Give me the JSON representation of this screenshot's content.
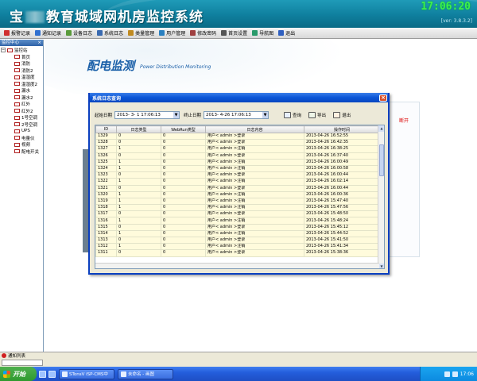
{
  "banner": {
    "title_prefix": "宝",
    "title_suffix": "教育城域网机房监控系统",
    "clock": "17:06:20",
    "version": "[ver: 3.8.3.2]"
  },
  "menu": [
    {
      "label": "报警记录",
      "icon": "alarm-log-icon",
      "color": "#d03030"
    },
    {
      "label": "通知记录",
      "icon": "notice-log-icon",
      "color": "#3070d0"
    },
    {
      "label": "设备日志",
      "icon": "device-log-icon",
      "color": "#5a9a3a"
    },
    {
      "label": "系统日志",
      "icon": "system-log-icon",
      "color": "#3a6ab0"
    },
    {
      "label": "类量管理",
      "icon": "type-manage-icon",
      "color": "#c08a20"
    },
    {
      "label": "用户管理",
      "icon": "user-manage-icon",
      "color": "#2a80c0"
    },
    {
      "label": "修改密码",
      "icon": "password-icon",
      "color": "#a04040"
    },
    {
      "label": "首页设置",
      "icon": "home-settings-icon",
      "color": "#555555"
    },
    {
      "label": "导航图",
      "icon": "nav-map-icon",
      "color": "#2a9a6a"
    },
    {
      "label": "退出",
      "icon": "exit-icon",
      "color": "#3060c0"
    }
  ],
  "left_panel": {
    "header": "监控中心",
    "root": "监控站",
    "items": [
      "首页",
      "消防",
      "消防2",
      "温湿度",
      "温湿度2",
      "漏水",
      "漏水2",
      "红外",
      "红外2",
      "1号空调",
      "2号空调",
      "UPS",
      "电量仪",
      "视频",
      "配电开关"
    ]
  },
  "page": {
    "title": "配电监测",
    "subtitle": "Power Distribution Monitoring",
    "status_text": "断开"
  },
  "dialog": {
    "title": "系统日志查询",
    "start_label": "起始日期",
    "start_value": "2013- 3- 1  17:06:13",
    "end_label": "终止日期",
    "end_value": "2013- 4-26  17:06:13",
    "buttons": [
      "查询",
      "导出",
      "退出"
    ],
    "columns": [
      "ID",
      "日志类型",
      "WebRun类型",
      "日志内容",
      "操作时间"
    ],
    "rows": [
      [
        "1329",
        "0",
        "0",
        "用户< admin >登录",
        "2013-04-26 16:52:55"
      ],
      [
        "1328",
        "0",
        "0",
        "用户< admin >登录",
        "2013-04-26 16:42:35"
      ],
      [
        "1327",
        "1",
        "0",
        "用户< admin >注销",
        "2013-04-26 16:38:25"
      ],
      [
        "1326",
        "0",
        "0",
        "用户< admin >登录",
        "2013-04-26 16:37:40"
      ],
      [
        "1325",
        "1",
        "0",
        "用户< admin >注销",
        "2013-04-26 16:00:49"
      ],
      [
        "1324",
        "1",
        "0",
        "用户< admin >注销",
        "2013-04-26 16:00:58"
      ],
      [
        "1323",
        "0",
        "0",
        "用户< admin >登录",
        "2013-04-26 16:00:44"
      ],
      [
        "1322",
        "1",
        "0",
        "用户< admin >注销",
        "2013-04-26 16:02:14"
      ],
      [
        "1321",
        "0",
        "0",
        "用户< admin >登录",
        "2013-04-26 16:00:44"
      ],
      [
        "1320",
        "1",
        "0",
        "用户< admin >注销",
        "2013-04-26 16:00:36"
      ],
      [
        "1319",
        "1",
        "0",
        "用户< admin >注销",
        "2013-04-26 15:47:40"
      ],
      [
        "1318",
        "1",
        "0",
        "用户< admin >注销",
        "2013-04-26 15:47:56"
      ],
      [
        "1317",
        "0",
        "0",
        "用户< admin >登录",
        "2013-04-26 15:48:50"
      ],
      [
        "1316",
        "1",
        "0",
        "用户< admin >注销",
        "2013-04-26 15:48:24"
      ],
      [
        "1315",
        "0",
        "0",
        "用户< admin >登录",
        "2013-04-26 15:45:12"
      ],
      [
        "1314",
        "1",
        "0",
        "用户< admin >注销",
        "2013-04-26 15:44:52"
      ],
      [
        "1313",
        "0",
        "0",
        "用户< admin >登录",
        "2013-04-26 15:41:50"
      ],
      [
        "1312",
        "1",
        "0",
        "用户< admin >注销",
        "2013-04-26 15:41:34"
      ],
      [
        "1311",
        "0",
        "0",
        "用户< admin >登录",
        "2013-04-26 15:38:36"
      ]
    ]
  },
  "status_bar": {
    "label": "通知列表"
  },
  "taskbar": {
    "start_label": "开始",
    "tasks": [
      "STonsV iSP-CMS中",
      "未命名 - 画图"
    ],
    "clock": "17:06"
  },
  "colors": {
    "banner": "#0f7f9e",
    "accent_title": "#1a5fa8",
    "clock_green": "#3ef04a",
    "dialog_border": "#0a3fc0",
    "row_bg": "#fffbdc"
  }
}
